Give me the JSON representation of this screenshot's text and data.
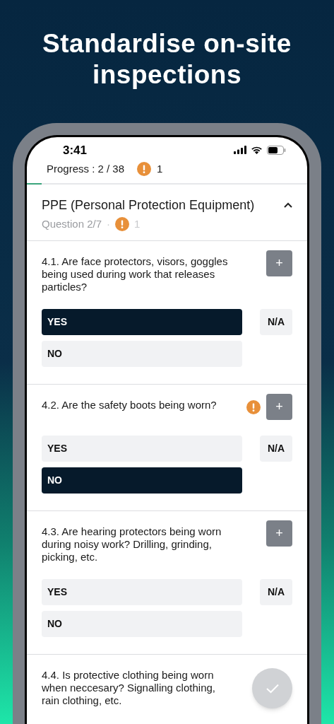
{
  "headline": [
    "Standardise on-site",
    "inspections"
  ],
  "status_bar": {
    "time": "3:41"
  },
  "progress": {
    "label": "Progress : 2 / 38",
    "warnings": "1",
    "level": 0.053
  },
  "section": {
    "title": "PPE (Personal Protection Equipment)",
    "expanded": true,
    "subtitle": "Question 2/7",
    "separator": "·",
    "warnings": "1"
  },
  "questions": [
    {
      "text": "4.1. Are face protectors, visors, goggles being used during work that releases particles?",
      "warning": false,
      "add": "+",
      "answers": [
        {
          "label": "YES",
          "selected": true
        },
        {
          "label": "NO",
          "selected": false
        }
      ],
      "na": {
        "label": "N/A",
        "selected": false
      }
    },
    {
      "text": "4.2. Are the safety boots being worn?",
      "warning": true,
      "add": "+",
      "answers": [
        {
          "label": "YES",
          "selected": false
        },
        {
          "label": "NO",
          "selected": true
        }
      ],
      "na": {
        "label": "N/A",
        "selected": false
      }
    },
    {
      "text": "4.3. Are hearing protectors being worn during noisy work? Drilling, grinding, picking, etc.",
      "warning": false,
      "add": "+",
      "answers": [
        {
          "label": "YES",
          "selected": false
        },
        {
          "label": "NO",
          "selected": false
        }
      ],
      "na": {
        "label": "N/A",
        "selected": false
      }
    },
    {
      "text": "4.4. Is protective clothing being worn when neccesary? Signalling clothing, rain clothing, etc.",
      "warning": false
    }
  ]
}
